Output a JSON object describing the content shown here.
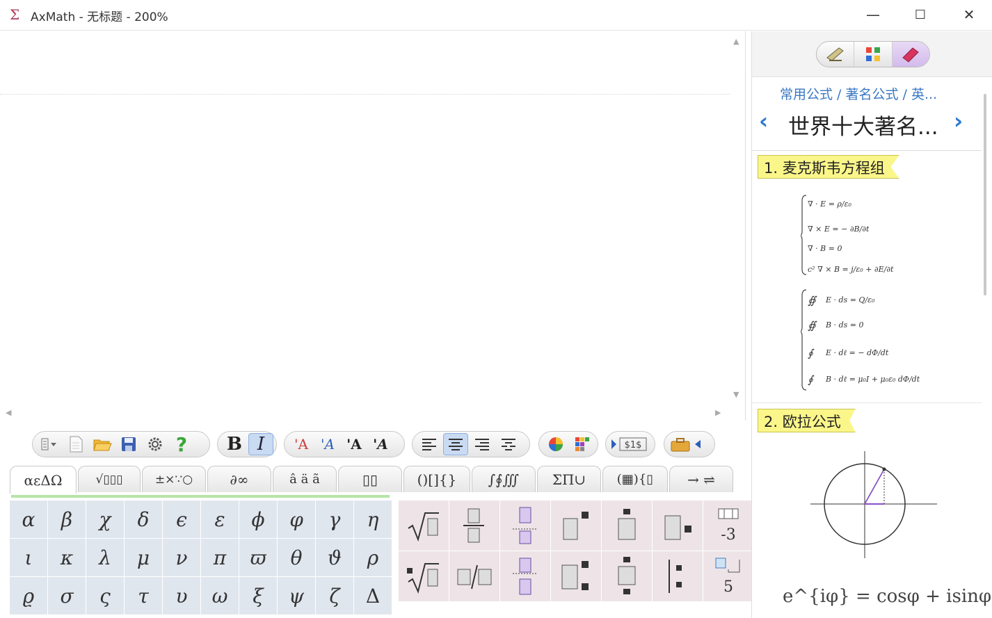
{
  "window": {
    "title": "AxMath - 无标题 - 200%",
    "app_icon": "Σ",
    "controls": {
      "minimize": "—",
      "maximize": "☐",
      "close": "✕"
    }
  },
  "toolbar": {
    "bold": "B",
    "italic": "I",
    "style_buttons": [
      "'A",
      "'A",
      "'A",
      "'A"
    ],
    "icons": [
      "list-dropdown-icon",
      "new-document-icon",
      "open-folder-icon",
      "save-icon",
      "settings-gear-icon",
      "help-icon",
      "align-left-icon",
      "align-center-icon",
      "align-right-icon",
      "align-distribute-icon",
      "color-wheel-icon",
      "color-grid-icon",
      "insert-dollar-icon",
      "toolbox-icon"
    ]
  },
  "symbol_tabs": [
    "αεΔΩ",
    "√▯▯▯",
    "±×∵○",
    "∂∞",
    "â ä ã",
    "▯▯",
    "()[]{}",
    "∫∮∭",
    "ΣΠ∪",
    "(▦){▯",
    "→ ⇌"
  ],
  "greek_symbols": [
    "α",
    "β",
    "χ",
    "δ",
    "ϵ",
    "ε",
    "ϕ",
    "φ",
    "γ",
    "η",
    "ι",
    "κ",
    "λ",
    "μ",
    "ν",
    "π",
    "ϖ",
    "θ",
    "ϑ",
    "ρ",
    "ϱ",
    "σ",
    "ς",
    "τ",
    "υ",
    "ω",
    "ξ",
    "ψ",
    "ζ",
    "Δ"
  ],
  "template_labels": {
    "minus_three": "-3",
    "five": "5"
  },
  "formula_panel": {
    "breadcrumb": "常用公式 / 著名公式 / 英...",
    "title": "世界十大著名...",
    "prev": "‹",
    "next": "›",
    "sections": [
      {
        "label": "1. 麦克斯韦方程组"
      },
      {
        "label": "2. 欧拉公式"
      }
    ],
    "euler_formula": "e^{iφ} = cosφ + isinφ"
  }
}
